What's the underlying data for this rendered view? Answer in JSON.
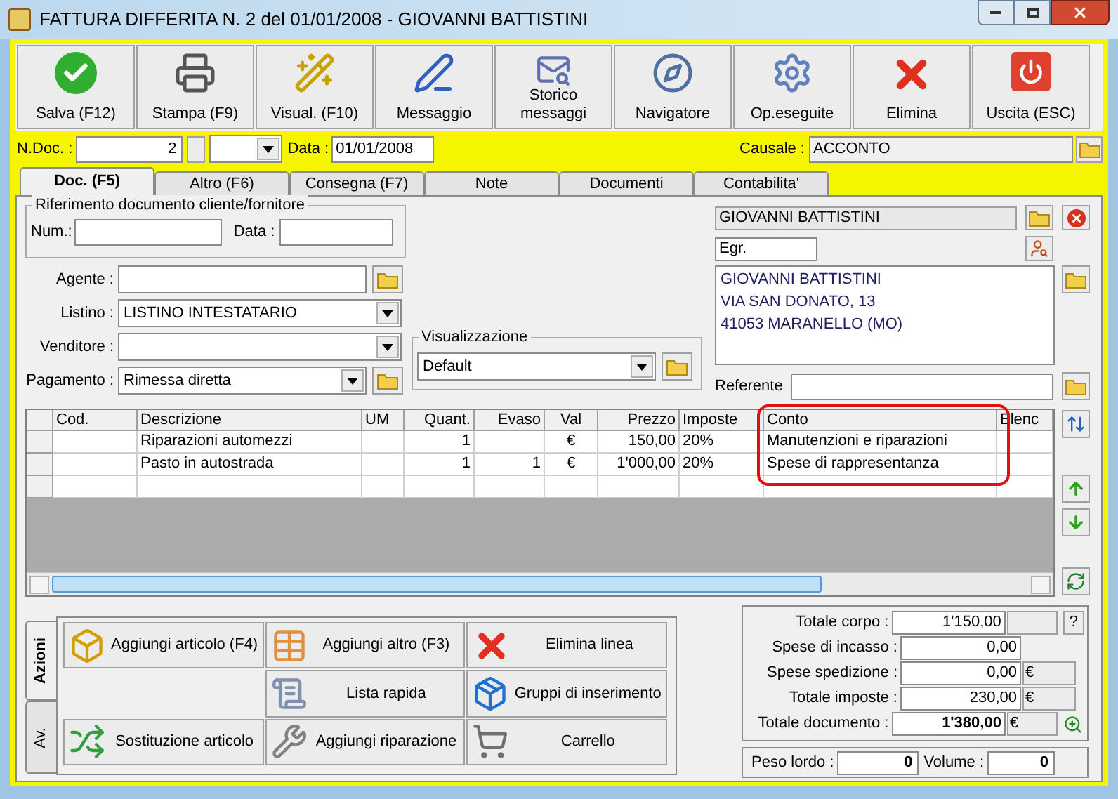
{
  "window": {
    "title": "FATTURA DIFFERITA N. 2  del 01/01/2008 - GIOVANNI BATTISTINI"
  },
  "toolbar": [
    {
      "label": "Salva (F12)"
    },
    {
      "label": "Stampa (F9)"
    },
    {
      "label": "Visual. (F10)"
    },
    {
      "label": "Messaggio"
    },
    {
      "label": "Storico messaggi"
    },
    {
      "label": "Navigatore"
    },
    {
      "label": "Op.eseguite"
    },
    {
      "label": "Elimina"
    },
    {
      "label": "Uscita (ESC)"
    }
  ],
  "header": {
    "ndoc_label": "N.Doc. :",
    "ndoc_value": "2",
    "date_label": "Data :",
    "date_value": "01/01/2008",
    "causale_label": "Causale :",
    "causale_value": "ACCONTO"
  },
  "tabs": [
    {
      "label": "Doc. (F5)",
      "selected": true
    },
    {
      "label": "Altro (F6)",
      "selected": false
    },
    {
      "label": "Consegna (F7)",
      "selected": false
    },
    {
      "label": "Note",
      "selected": false
    },
    {
      "label": "Documenti",
      "selected": false
    },
    {
      "label": "Contabilita'",
      "selected": false
    }
  ],
  "reference": {
    "title": "Riferimento documento cliente/fornitore",
    "num_label": "Num.:",
    "data_label": "Data :"
  },
  "fields": [
    {
      "label": "Agente :",
      "kind": "folder"
    },
    {
      "label": "Listino :",
      "value": "LISTINO INTESTATARIO",
      "kind": "combo"
    },
    {
      "label": "Venditore :",
      "kind": "combo"
    },
    {
      "label": "Pagamento :",
      "value": "Rimessa diretta",
      "kind": "combo-folder"
    }
  ],
  "view": {
    "title": "Visualizzazione",
    "value": "Default"
  },
  "customer": {
    "name": "GIOVANNI BATTISTINI",
    "salutation": "Egr.",
    "address": [
      "GIOVANNI BATTISTINI",
      "VIA SAN DONATO, 13",
      "41053 MARANELLO (MO)"
    ],
    "referente_label": "Referente"
  },
  "table": {
    "columns": [
      "Cod.",
      "Descrizione",
      "UM",
      "Quant.",
      "Evaso",
      "Val",
      "Prezzo",
      "Imposte",
      "Conto",
      "Elenc"
    ],
    "rows": [
      [
        "",
        "Riparazioni automezzi",
        "",
        "1",
        "",
        "€",
        "150,00",
        "20%",
        "Manutenzioni e riparazioni",
        ""
      ],
      [
        "",
        "Pasto in autostrada",
        "",
        "1",
        "1",
        "€",
        "1'000,00",
        "20%",
        "Spese di rappresentanza",
        ""
      ]
    ]
  },
  "side_tabs": [
    {
      "label": "Azioni",
      "selected": true
    },
    {
      "label": "Av.",
      "selected": false
    }
  ],
  "actions": [
    {
      "label": "Aggiungi articolo (F4)"
    },
    {
      "label": "Aggiungi altro (F3)"
    },
    {
      "label": "Elimina linea"
    },
    {
      "label": "Lista rapida"
    },
    {
      "label": "Gruppi di inserimento"
    },
    {
      "label": "Sostituzione articolo"
    },
    {
      "label": "Aggiungi riparazione"
    },
    {
      "label": "Carrello"
    }
  ],
  "totals": [
    {
      "label": "Totale corpo :",
      "value": "1'150,00",
      "kind": "corpo",
      "button": "?"
    },
    {
      "label": "Spese di incasso :",
      "value": "0,00",
      "kind": "plain"
    },
    {
      "label": "Spese spedizione :",
      "value": "0,00",
      "kind": "currency",
      "currency": "€"
    },
    {
      "label": "Totale imposte :",
      "value": "230,00",
      "kind": "currency",
      "currency": "€"
    },
    {
      "label": "Totale documento :",
      "value": "1'380,00",
      "kind": "grand",
      "currency": "€"
    }
  ],
  "weights": [
    {
      "label": "Peso lordo :",
      "value": "0"
    },
    {
      "label": "Volume :",
      "value": "0"
    }
  ]
}
